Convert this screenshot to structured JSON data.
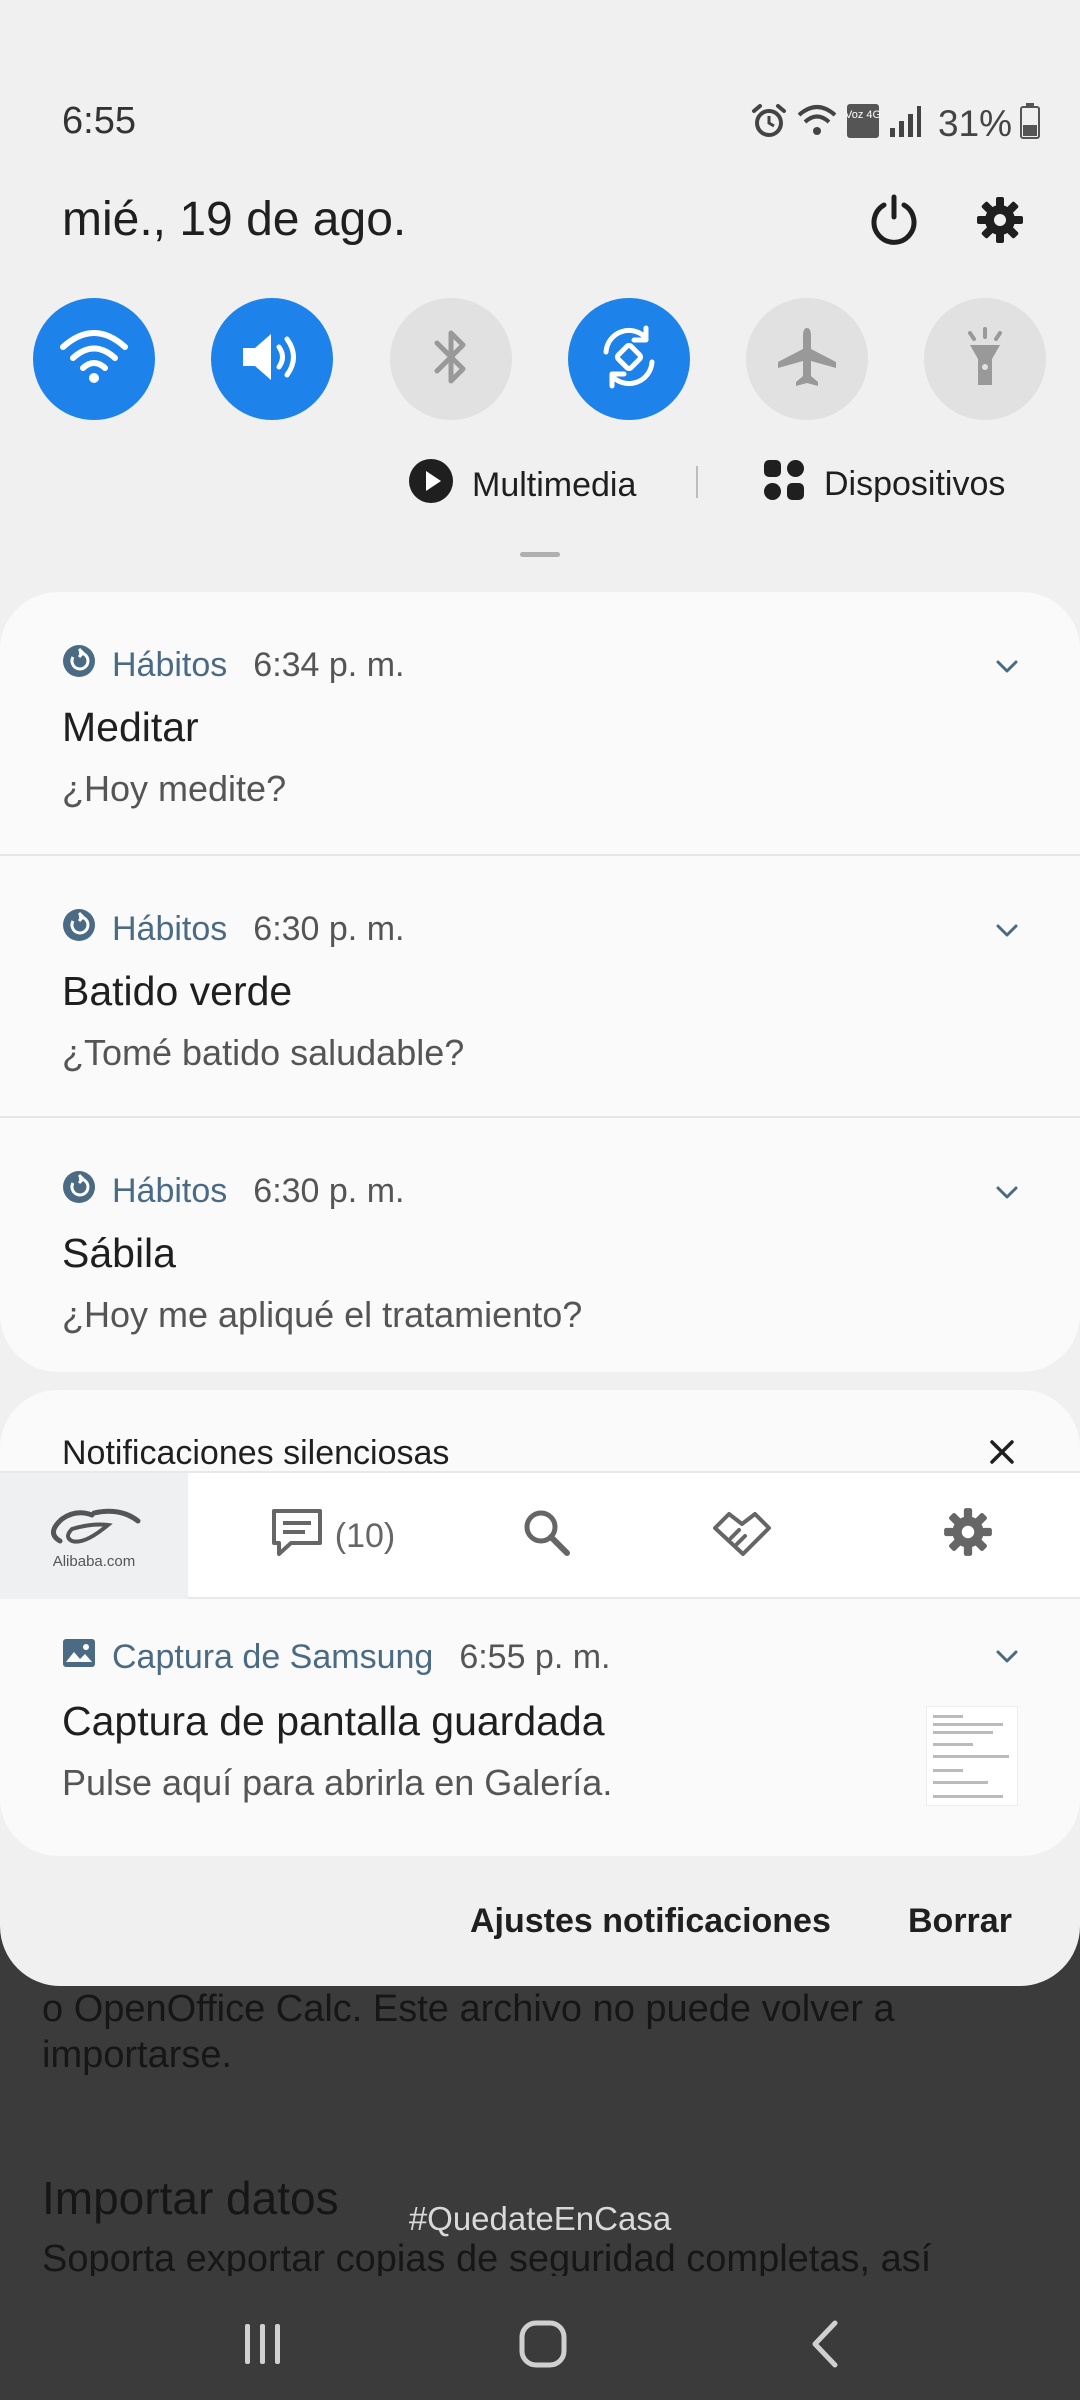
{
  "background_app": {
    "description_text": "o OpenOffice Calc. Este archivo no puede volver a importarse.",
    "section_title": "Importar datos",
    "section_desc": "Soporta exportar copias de seguridad completas, así",
    "hashtag": "#QuedateEnCasa"
  },
  "status_bar": {
    "time": "6:55",
    "network_label": "Voz 4G",
    "battery": "31%",
    "icons": [
      "alarm-icon",
      "wifi-icon",
      "volte-icon",
      "signal-icon",
      "battery-icon"
    ]
  },
  "header": {
    "date": "mié., 19 de ago.",
    "power_icon": "power-icon",
    "settings_icon": "gear-icon"
  },
  "quick_settings": [
    {
      "name": "wifi",
      "icon": "wifi-icon",
      "on": true
    },
    {
      "name": "sound",
      "icon": "speaker-icon",
      "on": true
    },
    {
      "name": "bluetooth",
      "icon": "bluetooth-icon",
      "on": false
    },
    {
      "name": "auto-rotate",
      "icon": "rotate-icon",
      "on": true
    },
    {
      "name": "airplane",
      "icon": "airplane-icon",
      "on": false
    },
    {
      "name": "flashlight",
      "icon": "flashlight-icon",
      "on": false
    }
  ],
  "media_row": {
    "media_label": "Multimedia",
    "devices_label": "Dispositivos"
  },
  "notifications": [
    {
      "app": "Hábitos",
      "time": "6:34 p. m.",
      "title": "Meditar",
      "body": "¿Hoy medite?"
    },
    {
      "app": "Hábitos",
      "time": "6:30 p. m.",
      "title": "Batido verde",
      "body": "¿Tomé batido saludable?"
    },
    {
      "app": "Hábitos",
      "time": "6:30 p. m.",
      "title": "Sábila",
      "body": "¿Hoy me apliqué el tratamiento?"
    }
  ],
  "silent": {
    "header": "Notificaciones silenciosas",
    "alibaba": {
      "logo_text": "Alibaba.com",
      "messages_count": "(10)",
      "icons": [
        "alibaba-logo",
        "message-icon",
        "search-icon",
        "handshake-icon",
        "gear-icon"
      ]
    },
    "screenshot": {
      "app": "Captura de Samsung",
      "time": "6:55 p. m.",
      "title": "Captura de pantalla guardada",
      "body": "Pulse aquí para abrirla en Galería."
    }
  },
  "footer": {
    "settings_label": "Ajustes notificaciones",
    "clear_label": "Borrar"
  },
  "navbar": {
    "icons": [
      "recents-icon",
      "home-icon",
      "back-icon"
    ]
  },
  "colors": {
    "accent": "#1d82ea",
    "tile_off": "#e1e1e1",
    "app_label": "#4b6b85",
    "shade_bg": "#f0f0f0"
  }
}
